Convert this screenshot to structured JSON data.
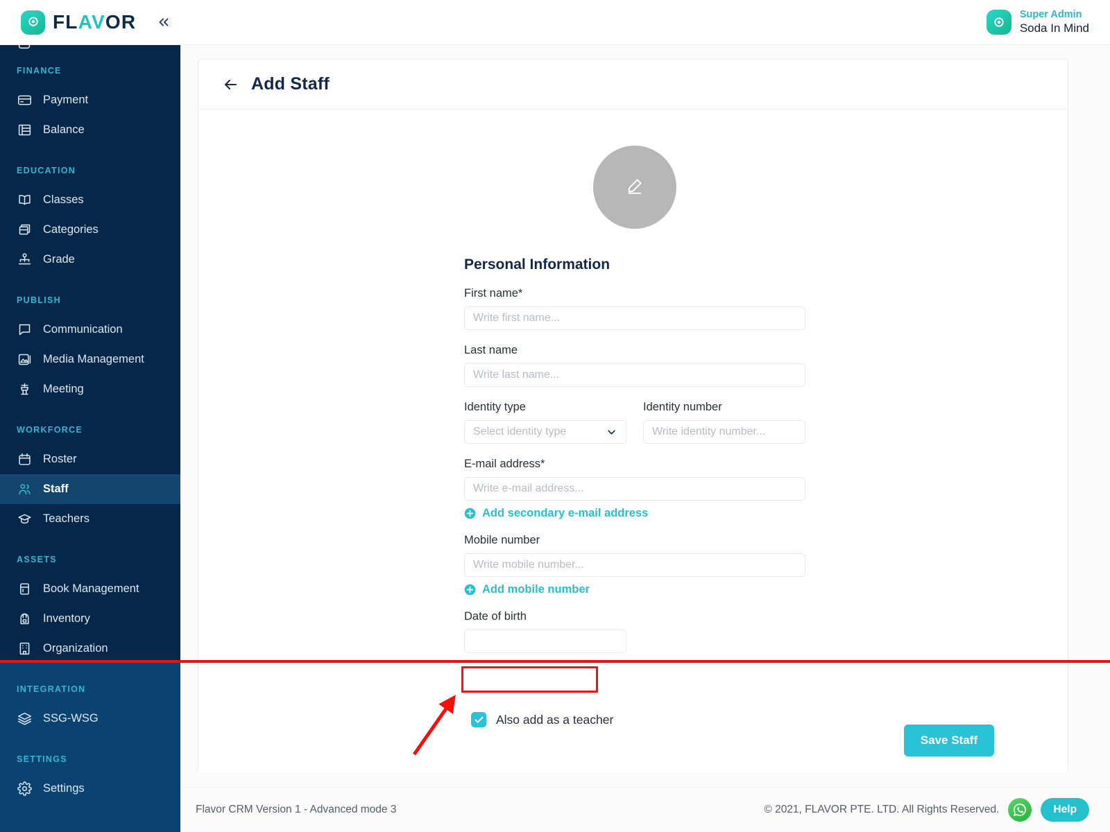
{
  "topbar": {
    "brand_part1": "FL",
    "brand_a": "A",
    "brand_v": "V",
    "brand_part2": "OR",
    "brand_part3": "",
    "logo_icon": "flavor-target-logo",
    "collapse_icon": "chevron-double-left-icon",
    "account": {
      "role": "Super Admin",
      "name": "Soda In Mind",
      "avatar_icon": "flavor-target-logo"
    }
  },
  "sidebar": {
    "sections": [
      {
        "label": "FINANCE",
        "items": [
          {
            "label": "Payment",
            "icon": "credit-card-icon",
            "active": false
          },
          {
            "label": "Balance",
            "icon": "ledger-icon",
            "active": false
          }
        ]
      },
      {
        "label": "EDUCATION",
        "items": [
          {
            "label": "Classes",
            "icon": "book-open-icon",
            "active": false
          },
          {
            "label": "Categories",
            "icon": "boxes-icon",
            "active": false
          },
          {
            "label": "Grade",
            "icon": "hierarchy-icon",
            "active": false
          }
        ]
      },
      {
        "label": "PUBLISH",
        "items": [
          {
            "label": "Communication",
            "icon": "chat-bubble-icon",
            "active": false
          },
          {
            "label": "Media Management",
            "icon": "image-icon",
            "active": false
          },
          {
            "label": "Meeting",
            "icon": "podium-icon",
            "active": false
          }
        ]
      },
      {
        "label": "WORKFORCE",
        "items": [
          {
            "label": "Roster",
            "icon": "calendar-icon",
            "active": false
          },
          {
            "label": "Staff",
            "icon": "users-icon",
            "active": true
          },
          {
            "label": "Teachers",
            "icon": "graduation-cap-icon",
            "active": false
          }
        ]
      },
      {
        "label": "ASSETS",
        "items": [
          {
            "label": "Book Management",
            "icon": "book-icon",
            "active": false
          },
          {
            "label": "Inventory",
            "icon": "backpack-icon",
            "active": false
          },
          {
            "label": "Organization",
            "icon": "building-icon",
            "active": false
          }
        ]
      },
      {
        "label": "INTEGRATION",
        "items": [
          {
            "label": "SSG-WSG",
            "icon": "layers-icon",
            "active": false
          }
        ]
      },
      {
        "label": "SETTINGS",
        "items": [
          {
            "label": "Settings",
            "icon": "gear-icon",
            "active": false
          }
        ]
      }
    ]
  },
  "page": {
    "title": "Add Staff",
    "back_icon": "arrow-left-icon",
    "avatar": {
      "icon": "pencil-edit-icon",
      "color": "#b7b7b7"
    },
    "section_title": "Personal Information",
    "fields": {
      "first_name": {
        "label": "First name*",
        "placeholder": "Write first name...",
        "value": ""
      },
      "last_name": {
        "label": "Last name",
        "placeholder": "Write last name...",
        "value": ""
      },
      "identity_type": {
        "label": "Identity type",
        "placeholder": "Select identity type",
        "value": "",
        "chevron_icon": "chevron-down-icon"
      },
      "identity_number": {
        "label": "Identity number",
        "placeholder": "Write identity number...",
        "value": ""
      },
      "email": {
        "label": "E-mail address*",
        "placeholder": "Write e-mail address...",
        "value": ""
      },
      "mobile": {
        "label": "Mobile number",
        "placeholder": "Write mobile number...",
        "value": ""
      },
      "dob": {
        "label": "Date of birth",
        "placeholder": "",
        "value": ""
      }
    },
    "links": {
      "add_secondary_email": "Add secondary e-mail address",
      "add_mobile_number": "Add mobile number",
      "plus_icon": "plus-circle-icon"
    },
    "actions": {
      "checkbox_label": "Also add as a teacher",
      "checkbox_checked": true,
      "check_icon": "check-icon",
      "save_label": "Save Staff"
    }
  },
  "footer": {
    "version": "Flavor CRM Version 1 - Advanced mode 3",
    "copyright": "© 2021, FLAVOR PTE. LTD. All Rights Reserved.",
    "whatsapp_icon": "whatsapp-icon",
    "help_label": "Help"
  },
  "colors": {
    "sidebar_dark": "#04274a",
    "sidebar_light": "#0a4371",
    "accent_teal": "#29c2d6",
    "brand_navy": "#12284a",
    "annotation_red": "#fb0d0d",
    "whatsapp_green": "#23b33a"
  }
}
